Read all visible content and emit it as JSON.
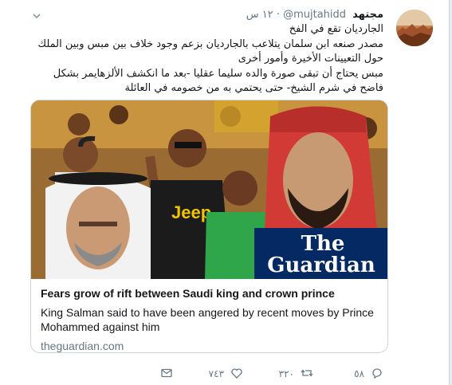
{
  "tweet": {
    "author_name": "مجتهد",
    "author_handle": "@mujtahidd",
    "dot": "·",
    "time": "١٢ س",
    "lines": [
      "الجارديان تقع في الفخ",
      "مصدر صنعه ابن سلمان يتلاعب بالجارديان بزعم وجود خلاف بين مبس وبين الملك",
      "حول التعيينات الأخيرة وأمور أخرى",
      "مبس يحتاج أن تبقى صورة والده سليما عقليا -بعد ما انكشف الألزهايمر بشكل",
      "فاضح في شرم الشيخ- حتى يحتمي به من خصومه في العائلة"
    ]
  },
  "card": {
    "image_watermark_line1": "The",
    "image_watermark_line2": "Guardian",
    "jersey_text": "Jeep",
    "title": "Fears grow of rift between Saudi king and crown prince",
    "description": "King Salman said to have been angered by recent moves by Prince Mohammed against him",
    "domain": "theguardian.com"
  },
  "actions": {
    "replies": "٥٨",
    "retweets": "٣٢٠",
    "likes": "٧٤٣",
    "icons": [
      "reply-icon",
      "retweet-icon",
      "like-icon",
      "message-icon"
    ]
  },
  "colors": {
    "text": "#14171a",
    "muted": "#657786",
    "border": "#ccd6dd",
    "guardian_bg": "#052962"
  }
}
